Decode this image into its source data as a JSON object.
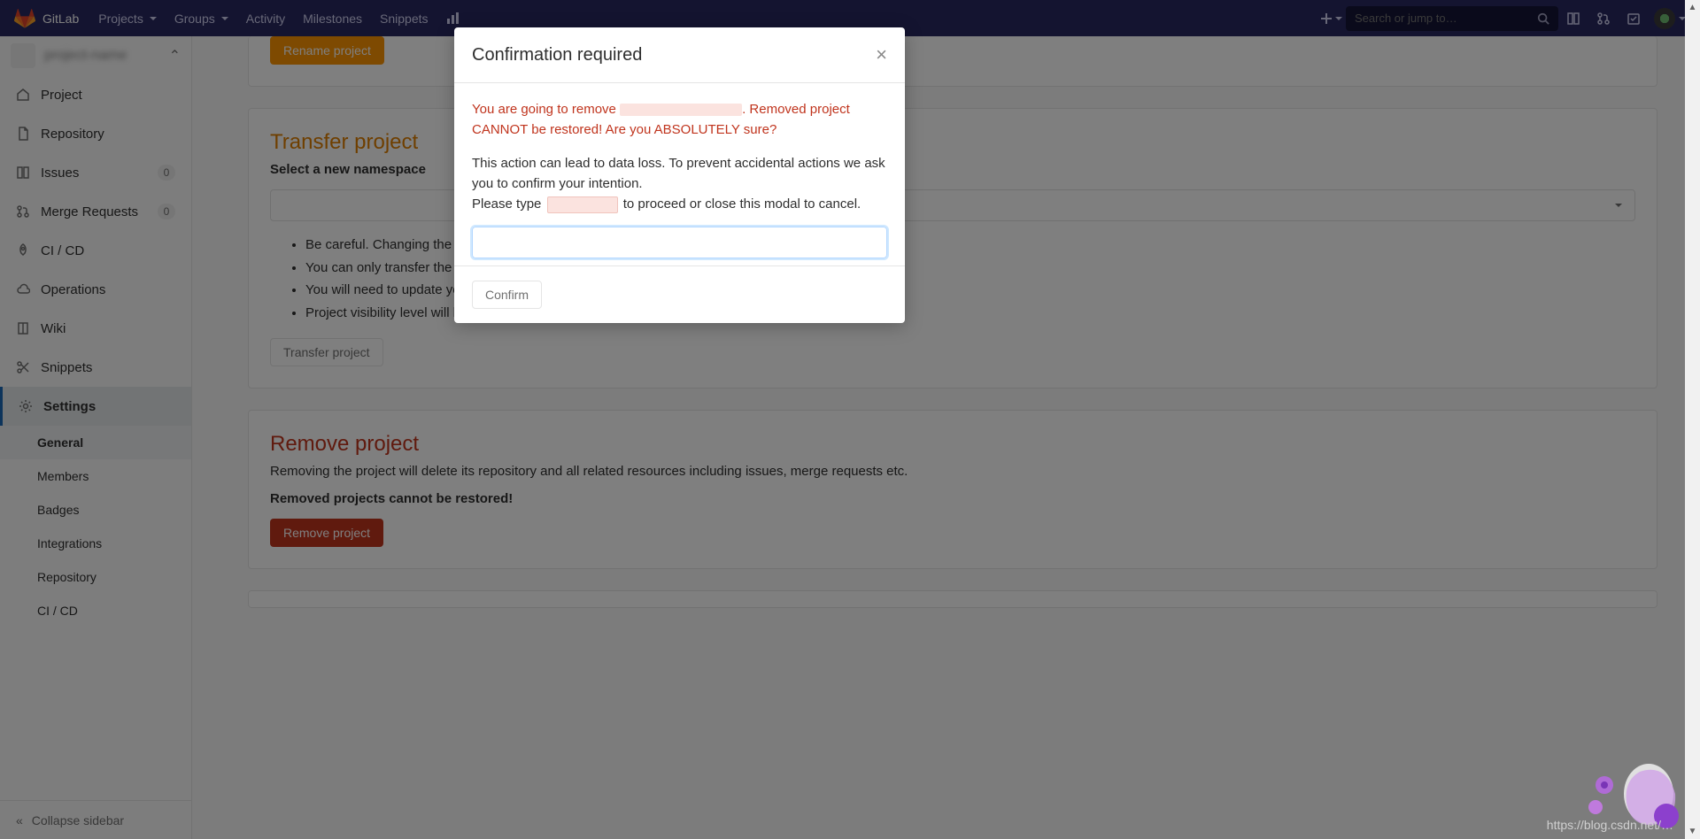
{
  "topnav": {
    "brand": "GitLab",
    "menu": [
      "Projects",
      "Groups",
      "Activity",
      "Milestones",
      "Snippets"
    ],
    "search_placeholder": "Search or jump to…"
  },
  "sidebar": {
    "items": [
      {
        "icon": "home-icon",
        "label": "Project"
      },
      {
        "icon": "file-icon",
        "label": "Repository"
      },
      {
        "icon": "issues-icon",
        "label": "Issues",
        "badge": "0"
      },
      {
        "icon": "merge-icon",
        "label": "Merge Requests",
        "badge": "0"
      },
      {
        "icon": "rocket-icon",
        "label": "CI / CD"
      },
      {
        "icon": "cloud-icon",
        "label": "Operations"
      },
      {
        "icon": "book-icon",
        "label": "Wiki"
      },
      {
        "icon": "scissors-icon",
        "label": "Snippets"
      },
      {
        "icon": "gear-icon",
        "label": "Settings",
        "active": true
      }
    ],
    "subitems": [
      "General",
      "Members",
      "Badges",
      "Integrations",
      "Repository",
      "CI / CD"
    ],
    "collapse_label": "Collapse sidebar"
  },
  "sections": {
    "rename": {
      "button": "Rename project"
    },
    "transfer": {
      "title": "Transfer project",
      "select_label": "Select a new namespace",
      "bullets": [
        "Be careful. Changing the project's namespace can have unintended side effects.",
        "You can only transfer the project to namespaces you manage.",
        "You will need to update your local repositories to point to the new location.",
        "Project visibility level will be changed to match namespace rules when transferring to a group."
      ],
      "button": "Transfer project"
    },
    "remove": {
      "title": "Remove project",
      "desc": "Removing the project will delete its repository and all related resources including issues, merge requests etc.",
      "warn": "Removed projects cannot be restored!",
      "button": "Remove project"
    }
  },
  "modal": {
    "title": "Confirmation required",
    "warn_prefix": "You are going to remove ",
    "warn_suffix": ". Removed project CANNOT be restored! Are you ABSOLUTELY sure?",
    "body1": "This action can lead to data loss. To prevent accidental actions we ask you to confirm your intention.",
    "body2_a": "Please type ",
    "body2_b": " to proceed or close this modal to cancel.",
    "confirm_button": "Confirm"
  },
  "watermark_url": "https://blog.csdn.net/…"
}
